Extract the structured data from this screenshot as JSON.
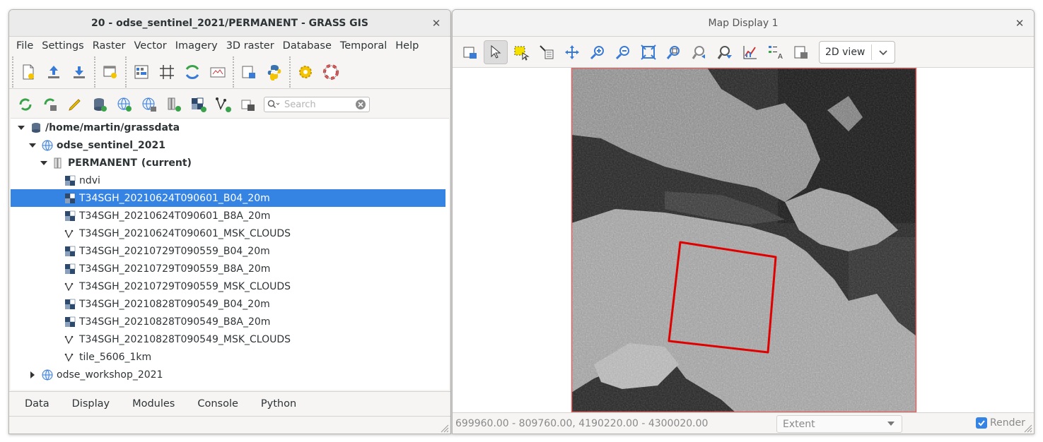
{
  "main_window": {
    "title": "20 - odse_sentinel_2021/PERMANENT - GRASS GIS",
    "close": "✕",
    "menu": [
      "File",
      "Settings",
      "Raster",
      "Vector",
      "Imagery",
      "3D raster",
      "Database",
      "Temporal",
      "Help"
    ],
    "search_placeholder": "Search",
    "tree": {
      "root": "/home/martin/grassdata",
      "location": "odse_sentinel_2021",
      "mapset": "PERMANENT",
      "mapset_suffix": "(current)",
      "layers": [
        {
          "name": "ndvi",
          "type": "raster"
        },
        {
          "name": "T34SGH_20210624T090601_B04_20m",
          "type": "raster",
          "selected": true
        },
        {
          "name": "T34SGH_20210624T090601_B8A_20m",
          "type": "raster"
        },
        {
          "name": "T34SGH_20210624T090601_MSK_CLOUDS",
          "type": "vector"
        },
        {
          "name": "T34SGH_20210729T090559_B04_20m",
          "type": "raster"
        },
        {
          "name": "T34SGH_20210729T090559_B8A_20m",
          "type": "raster"
        },
        {
          "name": "T34SGH_20210729T090559_MSK_CLOUDS",
          "type": "vector"
        },
        {
          "name": "T34SGH_20210828T090549_B04_20m",
          "type": "raster"
        },
        {
          "name": "T34SGH_20210828T090549_B8A_20m",
          "type": "raster"
        },
        {
          "name": "T34SGH_20210828T090549_MSK_CLOUDS",
          "type": "vector"
        },
        {
          "name": "tile_5606_1km",
          "type": "vector"
        }
      ],
      "other_location": "odse_workshop_2021"
    },
    "tabs": [
      "Data",
      "Display",
      "Modules",
      "Console",
      "Python"
    ]
  },
  "map_window": {
    "title": "Map Display 1",
    "close": "✕",
    "view_mode": "2D view",
    "coords": "699960.00 - 809760.00, 4190220.00 - 4300020.00",
    "status_mode": "Extent",
    "render_label": "Render",
    "render_checked": true
  },
  "colors": {
    "selection": "#3584e4",
    "region_outline": "#e00000",
    "window_bg": "#f6f5f4"
  }
}
